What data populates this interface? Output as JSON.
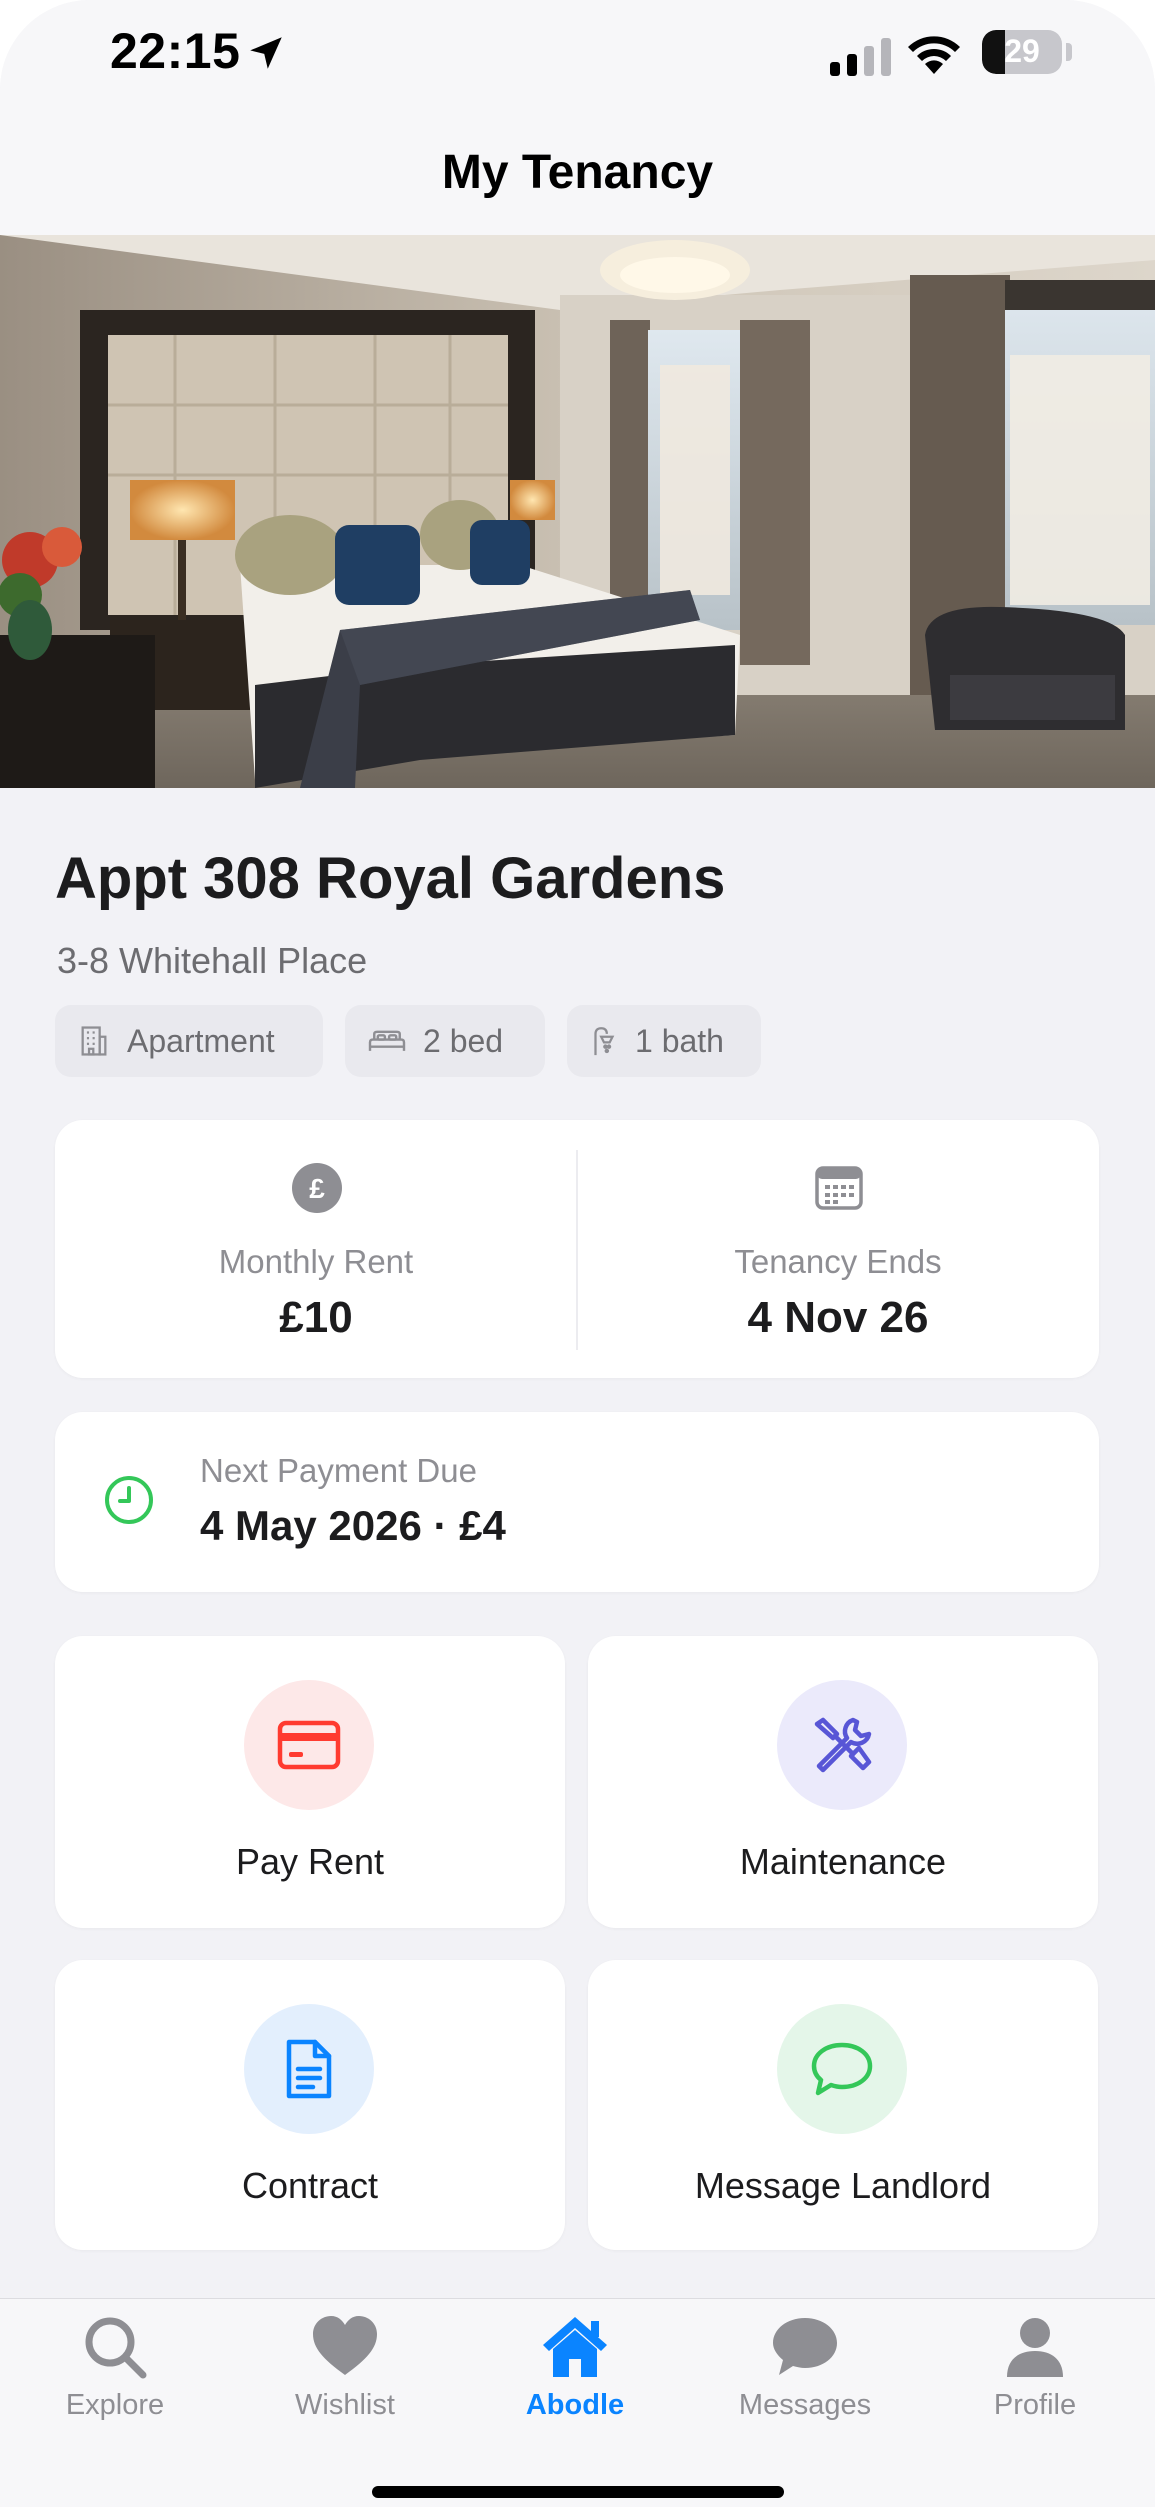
{
  "status_bar": {
    "time": "22:15",
    "battery": "29",
    "battery_level": 0.29
  },
  "nav": {
    "title": "My Tenancy"
  },
  "property": {
    "title": "Appt 308 Royal Gardens",
    "address": "3-8 Whitehall Place",
    "chips": [
      {
        "icon": "building-icon",
        "label": "Apartment"
      },
      {
        "icon": "bed-icon",
        "label": "2 bed"
      },
      {
        "icon": "shower-icon",
        "label": "1 bath"
      }
    ]
  },
  "summary": {
    "rent_label": "Monthly Rent",
    "rent_value": "£10",
    "rent_icon": "pound-icon",
    "ends_label": "Tenancy Ends",
    "ends_value": "4 Nov 26",
    "ends_icon": "calendar-icon"
  },
  "next_payment": {
    "label": "Next Payment Due",
    "value": "4 May 2026 · £4",
    "icon": "clock-icon",
    "accent": "#34c759"
  },
  "actions": [
    {
      "label": "Pay Rent",
      "icon": "credit-card-icon",
      "color": "#ff3b30",
      "bg": "#fde8e8"
    },
    {
      "label": "Maintenance",
      "icon": "tools-icon",
      "color": "#5856d6",
      "bg": "#ebeafb"
    },
    {
      "label": "Contract",
      "icon": "document-icon",
      "color": "#0a84ff",
      "bg": "#e3effd"
    },
    {
      "label": "Message Landlord",
      "icon": "chat-icon",
      "color": "#34c759",
      "bg": "#e4f6e9"
    }
  ],
  "tabs": [
    {
      "label": "Explore",
      "icon": "search-icon",
      "active": false
    },
    {
      "label": "Wishlist",
      "icon": "heart-icon",
      "active": false
    },
    {
      "label": "Abodle",
      "icon": "home-icon",
      "active": true
    },
    {
      "label": "Messages",
      "icon": "messages-icon",
      "active": false
    },
    {
      "label": "Profile",
      "icon": "person-icon",
      "active": false
    }
  ],
  "colors": {
    "accent": "#0a84ff",
    "tab_inactive": "#8e8e93",
    "background": "#f2f2f6"
  }
}
